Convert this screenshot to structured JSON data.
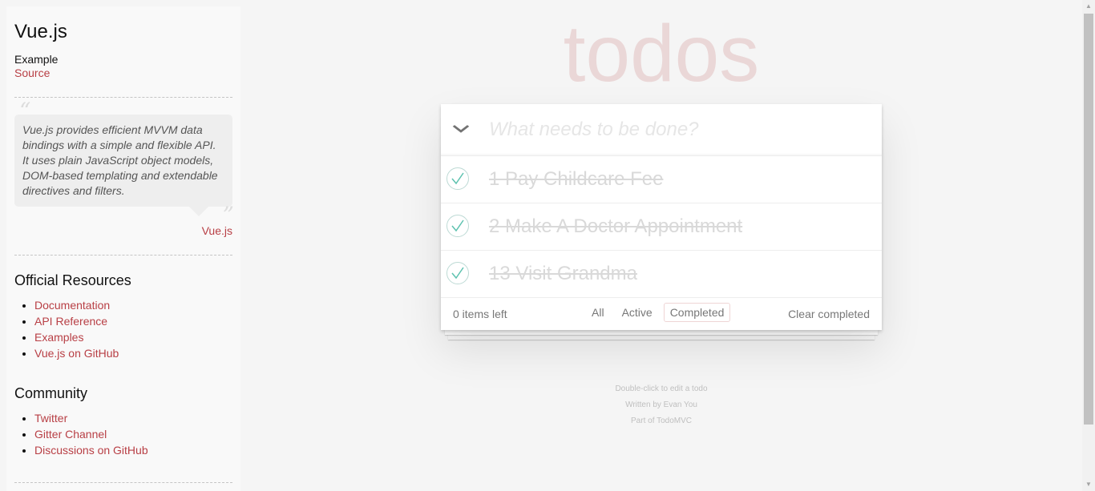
{
  "sidebar": {
    "title": "Vue.js",
    "example_label": "Example",
    "source_link": "Source",
    "quote": "Vue.js provides efficient MVVM data bindings with a simple and flexible API. It uses plain JavaScript object models, DOM-based templating and extendable directives and filters.",
    "quote_open": "“",
    "quote_close": "”",
    "quote_cite": "Vue.js",
    "official_title": "Official Resources",
    "official_links": [
      "Documentation",
      "API Reference",
      "Examples",
      "Vue.js on GitHub"
    ],
    "community_title": "Community",
    "community_links": [
      "Twitter",
      "Gitter Channel",
      "Discussions on GitHub"
    ]
  },
  "app": {
    "title": "todos",
    "toggle_all_glyph": "❯",
    "new_todo_placeholder": "What needs to be done?",
    "todos": [
      {
        "label": "1 Pay Childcare Fee",
        "completed": true
      },
      {
        "label": "2 Make A Doctor Appointment",
        "completed": true
      },
      {
        "label": "13 Visit Grandma",
        "completed": true
      }
    ],
    "footer": {
      "count": "0 items left",
      "filters": [
        "All",
        "Active",
        "Completed"
      ],
      "selected_filter": "Completed",
      "clear_completed": "Clear completed"
    }
  },
  "info": {
    "line1": "Double-click to edit a todo",
    "line2": "Written by Evan You",
    "line3": "Part of TodoMVC"
  },
  "colors": {
    "accent": "#b83f45",
    "check_green": "#5dc2af",
    "background": "#f5f5f5"
  }
}
